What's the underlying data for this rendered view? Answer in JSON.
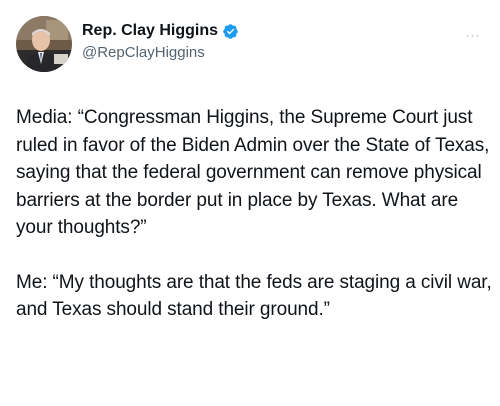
{
  "author": {
    "display_name": "Rep. Clay Higgins",
    "handle": "@RepClayHiggins",
    "verified_badge_icon": "verified-badge-icon",
    "avatar_icon": "avatar-photo"
  },
  "more_menu": {
    "label": "···",
    "icon": "more-options-icon"
  },
  "tweet": {
    "paragraph_1": "Media: “Congressman Higgins, the Supreme Court just ruled in favor of the Biden Admin over the State of Texas, saying that the federal government can remove physical barriers at the border put in place by Texas. What are your thoughts?”",
    "paragraph_2": "Me: “My thoughts are that the feds are staging a civil war, and Texas should stand their ground.”"
  },
  "colors": {
    "text": "#0f1419",
    "secondary_text": "#536471",
    "verified": "#1d9bf0",
    "background": "#ffffff"
  }
}
